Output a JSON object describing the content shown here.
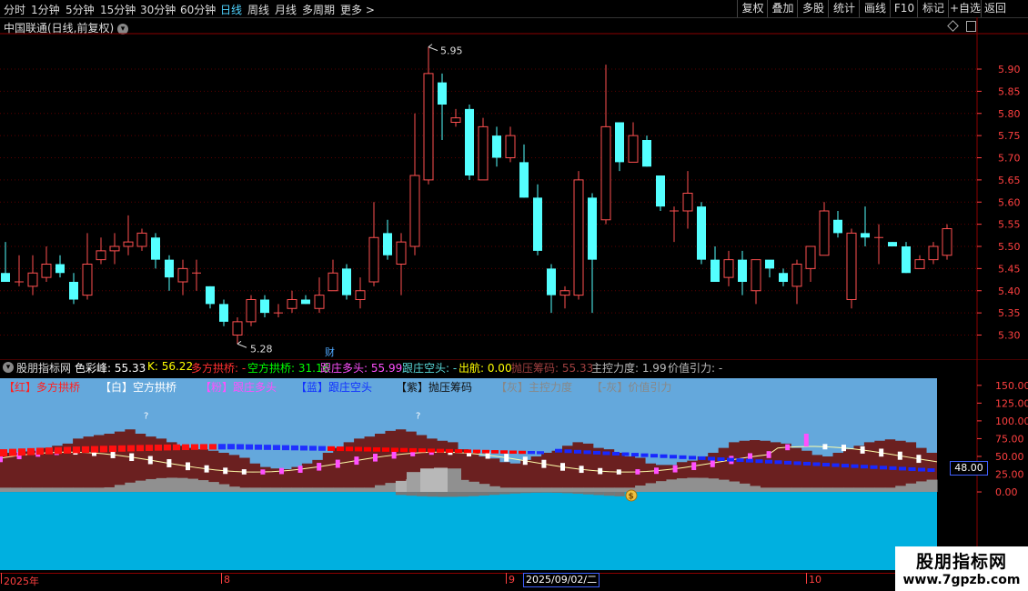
{
  "toolbar": {
    "periods": [
      "分时",
      "1分钟",
      "5分钟",
      "15分钟",
      "30分钟",
      "60分钟",
      "日线",
      "周线",
      "月线",
      "多周期",
      "更多 >"
    ],
    "active_period": "日线",
    "right_buttons": [
      "复权",
      "叠加",
      "多股",
      "统计",
      "画线",
      "F10",
      "标记",
      "+自选",
      "返回"
    ]
  },
  "main_chart": {
    "title": "中国联通(日线,前复权)",
    "high_label": "5.95",
    "low_label": "5.28",
    "fin_marker": "财",
    "y_ticks": [
      "5.90",
      "5.85",
      "5.80",
      "5.75",
      "5.70",
      "5.65",
      "5.60",
      "5.55",
      "5.50",
      "5.45",
      "5.40",
      "5.35",
      "5.30"
    ]
  },
  "chart_data": {
    "type": "candlestick",
    "ylim": [
      5.26,
      5.98
    ],
    "up_color": "#ff5050",
    "down_color": "#54ffff",
    "candles": [
      {
        "o": 5.44,
        "c": 5.42,
        "h": 5.51,
        "l": 5.42
      },
      {
        "o": 5.42,
        "c": 5.42,
        "h": 5.48,
        "l": 5.41
      },
      {
        "o": 5.41,
        "c": 5.44,
        "h": 5.48,
        "l": 5.39
      },
      {
        "o": 5.43,
        "c": 5.46,
        "h": 5.5,
        "l": 5.42
      },
      {
        "o": 5.46,
        "c": 5.44,
        "h": 5.48,
        "l": 5.43
      },
      {
        "o": 5.42,
        "c": 5.38,
        "h": 5.44,
        "l": 5.37
      },
      {
        "o": 5.39,
        "c": 5.46,
        "h": 5.53,
        "l": 5.38
      },
      {
        "o": 5.47,
        "c": 5.49,
        "h": 5.52,
        "l": 5.46
      },
      {
        "o": 5.49,
        "c": 5.5,
        "h": 5.53,
        "l": 5.46
      },
      {
        "o": 5.5,
        "c": 5.51,
        "h": 5.57,
        "l": 5.48
      },
      {
        "o": 5.5,
        "c": 5.53,
        "h": 5.54,
        "l": 5.49
      },
      {
        "o": 5.52,
        "c": 5.47,
        "h": 5.53,
        "l": 5.45
      },
      {
        "o": 5.47,
        "c": 5.43,
        "h": 5.48,
        "l": 5.4
      },
      {
        "o": 5.42,
        "c": 5.45,
        "h": 5.47,
        "l": 5.39
      },
      {
        "o": 5.44,
        "c": 5.44,
        "h": 5.47,
        "l": 5.4
      },
      {
        "o": 5.41,
        "c": 5.37,
        "h": 5.41,
        "l": 5.36
      },
      {
        "o": 5.37,
        "c": 5.33,
        "h": 5.38,
        "l": 5.32
      },
      {
        "o": 5.3,
        "c": 5.33,
        "h": 5.34,
        "l": 5.28
      },
      {
        "o": 5.33,
        "c": 5.38,
        "h": 5.39,
        "l": 5.32
      },
      {
        "o": 5.38,
        "c": 5.35,
        "h": 5.39,
        "l": 5.34
      },
      {
        "o": 5.35,
        "c": 5.35,
        "h": 5.37,
        "l": 5.34
      },
      {
        "o": 5.36,
        "c": 5.38,
        "h": 5.4,
        "l": 5.35
      },
      {
        "o": 5.38,
        "c": 5.37,
        "h": 5.39,
        "l": 5.37
      },
      {
        "o": 5.36,
        "c": 5.39,
        "h": 5.43,
        "l": 5.35
      },
      {
        "o": 5.4,
        "c": 5.44,
        "h": 5.47,
        "l": 5.4
      },
      {
        "o": 5.45,
        "c": 5.39,
        "h": 5.46,
        "l": 5.38
      },
      {
        "o": 5.38,
        "c": 5.4,
        "h": 5.43,
        "l": 5.36
      },
      {
        "o": 5.42,
        "c": 5.52,
        "h": 5.6,
        "l": 5.41
      },
      {
        "o": 5.53,
        "c": 5.48,
        "h": 5.56,
        "l": 5.47
      },
      {
        "o": 5.46,
        "c": 5.51,
        "h": 5.53,
        "l": 5.39
      },
      {
        "o": 5.5,
        "c": 5.66,
        "h": 5.8,
        "l": 5.48
      },
      {
        "o": 5.65,
        "c": 5.89,
        "h": 5.95,
        "l": 5.64
      },
      {
        "o": 5.87,
        "c": 5.82,
        "h": 5.89,
        "l": 5.74
      },
      {
        "o": 5.78,
        "c": 5.79,
        "h": 5.81,
        "l": 5.77
      },
      {
        "o": 5.81,
        "c": 5.66,
        "h": 5.82,
        "l": 5.65
      },
      {
        "o": 5.65,
        "c": 5.77,
        "h": 5.79,
        "l": 5.65
      },
      {
        "o": 5.75,
        "c": 5.7,
        "h": 5.77,
        "l": 5.68
      },
      {
        "o": 5.7,
        "c": 5.75,
        "h": 5.77,
        "l": 5.69
      },
      {
        "o": 5.69,
        "c": 5.61,
        "h": 5.73,
        "l": 5.61
      },
      {
        "o": 5.61,
        "c": 5.49,
        "h": 5.64,
        "l": 5.48
      },
      {
        "o": 5.45,
        "c": 5.39,
        "h": 5.46,
        "l": 5.35
      },
      {
        "o": 5.39,
        "c": 5.4,
        "h": 5.41,
        "l": 5.36
      },
      {
        "o": 5.39,
        "c": 5.65,
        "h": 5.67,
        "l": 5.38
      },
      {
        "o": 5.61,
        "c": 5.47,
        "h": 5.62,
        "l": 5.35
      },
      {
        "o": 5.56,
        "c": 5.77,
        "h": 5.91,
        "l": 5.55
      },
      {
        "o": 5.78,
        "c": 5.69,
        "h": 5.78,
        "l": 5.67
      },
      {
        "o": 5.69,
        "c": 5.75,
        "h": 5.78,
        "l": 5.69
      },
      {
        "o": 5.74,
        "c": 5.68,
        "h": 5.75,
        "l": 5.68
      },
      {
        "o": 5.66,
        "c": 5.59,
        "h": 5.66,
        "l": 5.58
      },
      {
        "o": 5.58,
        "c": 5.58,
        "h": 5.59,
        "l": 5.51
      },
      {
        "o": 5.58,
        "c": 5.62,
        "h": 5.67,
        "l": 5.54
      },
      {
        "o": 5.59,
        "c": 5.47,
        "h": 5.6,
        "l": 5.46
      },
      {
        "o": 5.47,
        "c": 5.42,
        "h": 5.5,
        "l": 5.42
      },
      {
        "o": 5.43,
        "c": 5.47,
        "h": 5.49,
        "l": 5.41
      },
      {
        "o": 5.47,
        "c": 5.42,
        "h": 5.49,
        "l": 5.39
      },
      {
        "o": 5.4,
        "c": 5.47,
        "h": 5.47,
        "l": 5.37
      },
      {
        "o": 5.47,
        "c": 5.45,
        "h": 5.46,
        "l": 5.43
      },
      {
        "o": 5.44,
        "c": 5.42,
        "h": 5.45,
        "l": 5.41
      },
      {
        "o": 5.41,
        "c": 5.46,
        "h": 5.47,
        "l": 5.37
      },
      {
        "o": 5.45,
        "c": 5.5,
        "h": 5.5,
        "l": 5.42
      },
      {
        "o": 5.48,
        "c": 5.58,
        "h": 5.6,
        "l": 5.48
      },
      {
        "o": 5.56,
        "c": 5.53,
        "h": 5.58,
        "l": 5.52
      },
      {
        "o": 5.38,
        "c": 5.53,
        "h": 5.54,
        "l": 5.36
      },
      {
        "o": 5.53,
        "c": 5.52,
        "h": 5.59,
        "l": 5.5
      },
      {
        "o": 5.52,
        "c": 5.52,
        "h": 5.55,
        "l": 5.46
      },
      {
        "o": 5.51,
        "c": 5.5,
        "h": 5.51,
        "l": 5.5
      },
      {
        "o": 5.5,
        "c": 5.44,
        "h": 5.51,
        "l": 5.44
      },
      {
        "o": 5.45,
        "c": 5.47,
        "h": 5.48,
        "l": 5.45
      },
      {
        "o": 5.47,
        "c": 5.5,
        "h": 5.51,
        "l": 5.46
      },
      {
        "o": 5.48,
        "c": 5.54,
        "h": 5.55,
        "l": 5.47
      }
    ]
  },
  "indicator": {
    "name": "股朋指标网",
    "header": [
      {
        "text": "色彩峰: 55.33",
        "color": "#ffffff"
      },
      {
        "text": "K: 56.22",
        "color": "#ffff00"
      },
      {
        "text": "多方拱桥: -",
        "color": "#ff3030"
      },
      {
        "text": "空方拱桥: 31.16",
        "color": "#00ff00"
      },
      {
        "text": "跟庄多头: 55.99",
        "color": "#ff50ff"
      },
      {
        "text": "跟庄空头: -",
        "color": "#5ad8d8"
      },
      {
        "text": "出航: 0.00",
        "color": "#ffff00"
      },
      {
        "text": "抛压筹码: 55.33",
        "color": "#a04040"
      },
      {
        "text": "主控力度: 1.99",
        "color": "#bbbbbb"
      },
      {
        "text": "价值引力: -",
        "color": "#bbbbbb"
      }
    ],
    "legend": [
      {
        "text": "【红】多方拱桥",
        "color": "#ff2020"
      },
      {
        "text": "【白】空方拱桥",
        "color": "#ffffff"
      },
      {
        "text": "【粉】跟庄多头",
        "color": "#ff50ff"
      },
      {
        "text": "【蓝】跟庄空头",
        "color": "#1030ff"
      },
      {
        "text": "【紫】抛压筹码",
        "color": "#111111"
      },
      {
        "text": "【灰】主控力度",
        "color": "#888888"
      },
      {
        "text": "【-灰】价值引力",
        "color": "#888888"
      }
    ],
    "y_ticks": [
      "150.00",
      "125.00",
      "100.00",
      "75.00",
      "50.00",
      "25.00",
      "0.00"
    ],
    "current_value": "48.00",
    "question_marks": [
      "?",
      "?"
    ],
    "ylim": [
      -110,
      160
    ],
    "chip_pressure": [
      55,
      55,
      57,
      58,
      62,
      65,
      68,
      75,
      78,
      80,
      82,
      85,
      88,
      82,
      78,
      75,
      70,
      65,
      62,
      60,
      58,
      55,
      52,
      48,
      40,
      35,
      33,
      32,
      35,
      40,
      45,
      55,
      62,
      70,
      75,
      78,
      82,
      86,
      88,
      85,
      80,
      75,
      72,
      70,
      60,
      55,
      50,
      47,
      42,
      40,
      45,
      50,
      55,
      58,
      65,
      70,
      68,
      62,
      60,
      55,
      50,
      48,
      40,
      38,
      38,
      42,
      44,
      50,
      55,
      62,
      70,
      72,
      73,
      72,
      70,
      68,
      62,
      58,
      52,
      50,
      55,
      60,
      65,
      70,
      72,
      74,
      72,
      70,
      62,
      55
    ]
  },
  "time_axis": {
    "labels": [
      "2025年",
      "8",
      "9",
      "10"
    ],
    "cursor_date": "2025/09/02/二"
  },
  "watermark": {
    "name": "股朋指标网",
    "url": "www.7gpzb.com"
  }
}
